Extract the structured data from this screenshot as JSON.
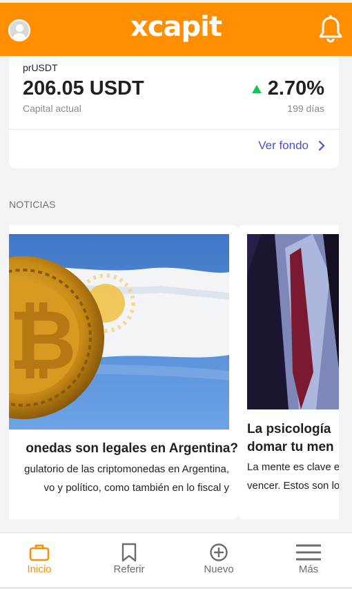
{
  "header": {
    "logo": "xcapit"
  },
  "fund": {
    "name": "prUSDT",
    "amount": "206.05 USDT",
    "capital_label": "Capital actual",
    "performance": "2.70%",
    "days": "199 días",
    "link": "Ver fondo"
  },
  "news": {
    "section_title": "NOTICIAS",
    "items": [
      {
        "title": "onedas son legales en Argentina?",
        "body_lines": [
          "gulatorio de las criptomonedas en Argentina,",
          "vo y político, como también en lo fiscal y"
        ]
      },
      {
        "title": "La psicología domar tu men",
        "body": "La mente es clave e vencer. Estos son lo"
      }
    ]
  },
  "nav": {
    "items": [
      {
        "label": "Inicio",
        "icon": "briefcase-icon",
        "active": true
      },
      {
        "label": "Referir",
        "icon": "bookmark-icon",
        "active": false
      },
      {
        "label": "Nuevo",
        "icon": "plus-circle-icon",
        "active": false
      },
      {
        "label": "Más",
        "icon": "menu-icon",
        "active": false
      }
    ]
  },
  "colors": {
    "brand": "#ff8f00",
    "link": "#4a4fd6",
    "positive": "#19c55a"
  }
}
